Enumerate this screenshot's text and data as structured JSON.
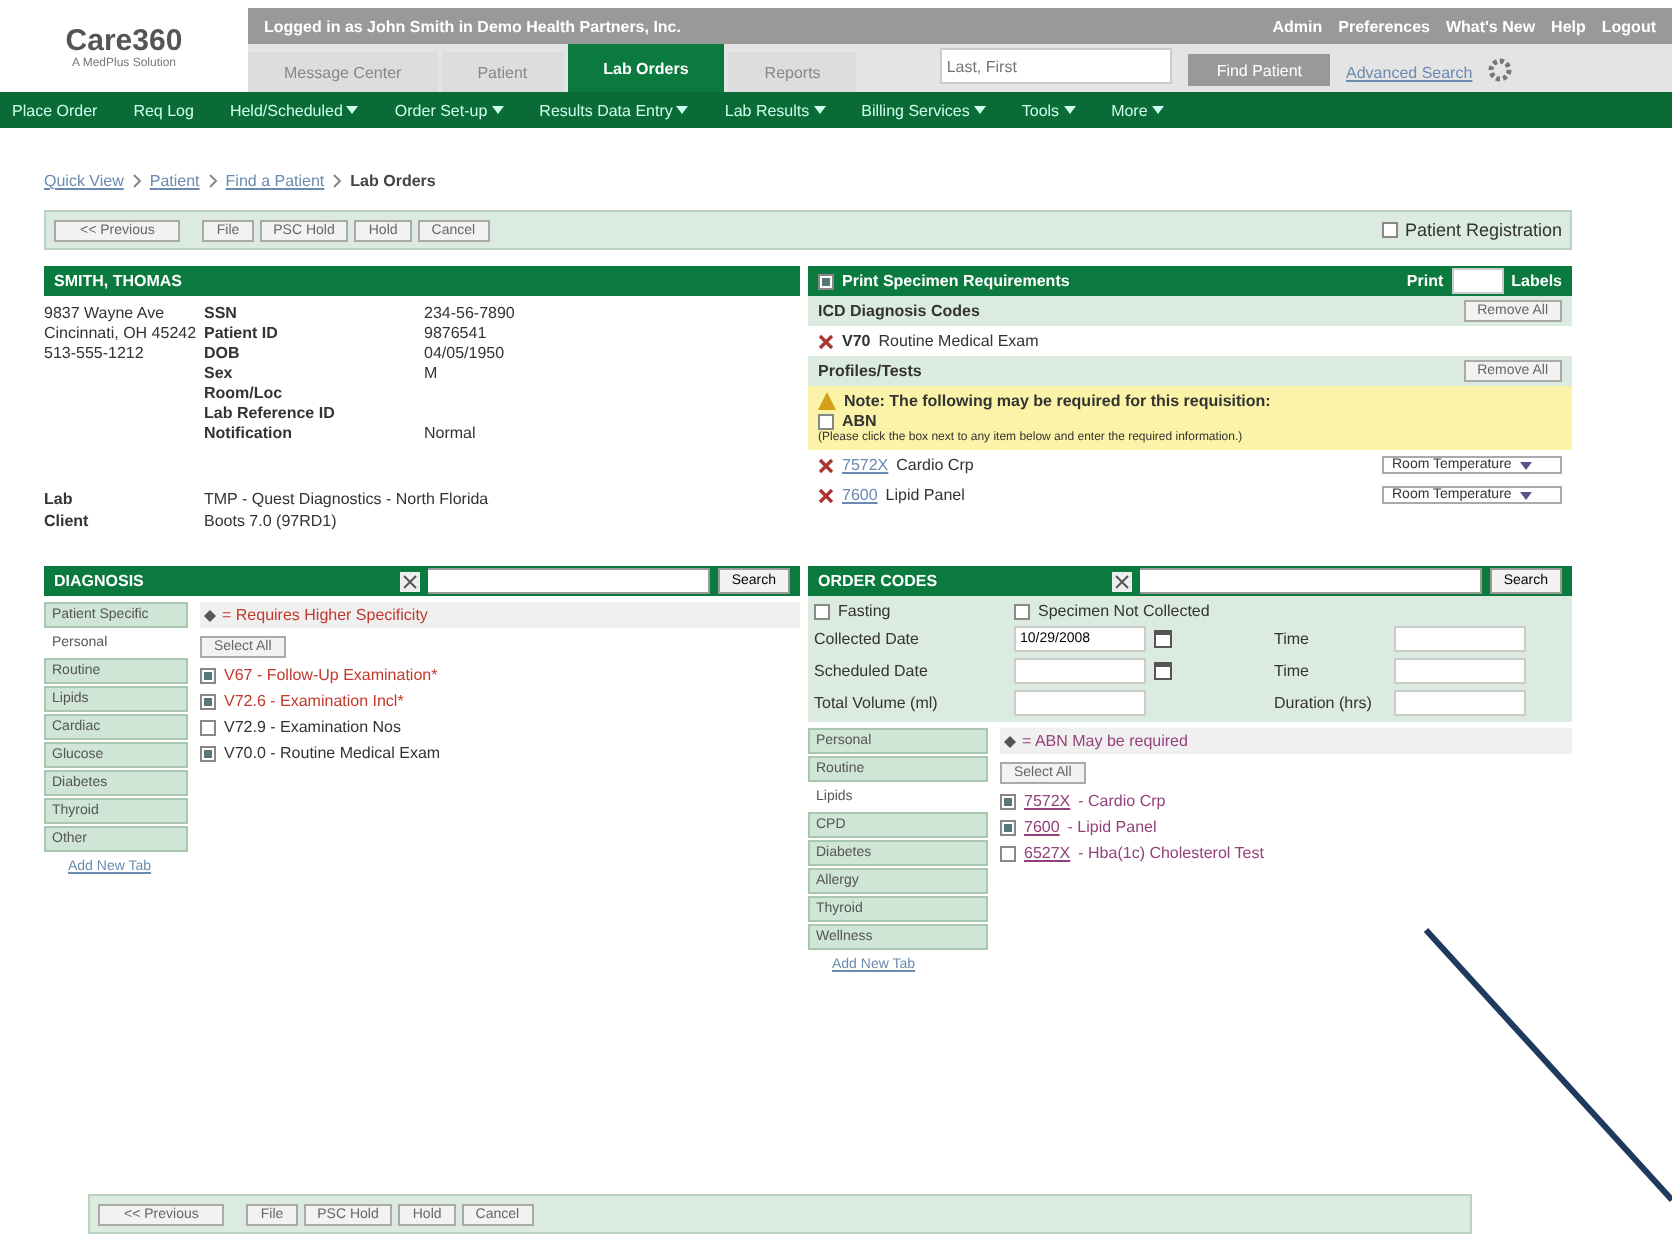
{
  "header": {
    "logo": "Care360",
    "logo_tagline": "A MedPlus Solution",
    "login_text": "Logged in as John Smith in Demo Health Partners, Inc.",
    "top_links": [
      "Admin",
      "Preferences",
      "What's New",
      "Help",
      "Logout"
    ],
    "tabs": [
      {
        "label": "Message Center",
        "selected": false
      },
      {
        "label": "Patient",
        "selected": false
      },
      {
        "label": "Lab Orders",
        "selected": true
      },
      {
        "label": "Reports",
        "selected": false
      }
    ],
    "search": {
      "placeholder": "Last, First"
    },
    "find_button": "Find Patient",
    "advanced_search": "Advanced Search"
  },
  "nav": [
    {
      "label": "Place Order",
      "dropdown": false
    },
    {
      "label": "Req Log",
      "dropdown": false
    },
    {
      "label": "Held/Scheduled",
      "dropdown": true
    },
    {
      "label": "Order Set-up",
      "dropdown": true
    },
    {
      "label": "Results Data Entry",
      "dropdown": true
    },
    {
      "label": "Lab Results",
      "dropdown": true
    },
    {
      "label": "Billing Services",
      "dropdown": true
    },
    {
      "label": "Tools",
      "dropdown": true
    },
    {
      "label": "More",
      "dropdown": true
    }
  ],
  "breadcrumb": [
    "Quick View",
    "Patient",
    "Find a Patient",
    "Lab Orders"
  ],
  "toolbar": {
    "buttons": [
      "<< Previous",
      "File",
      "PSC Hold",
      "Hold",
      "Cancel"
    ],
    "patient_registration": {
      "label": "Patient Registration",
      "checked": false
    }
  },
  "patient": {
    "name": "SMITH, THOMAS",
    "address": [
      "9837 Wayne Ave",
      "Cincinnati, OH 45242",
      "513-555-1212"
    ],
    "fields": [
      {
        "label": "SSN",
        "value": "234-56-7890"
      },
      {
        "label": "Patient ID",
        "value": "9876541"
      },
      {
        "label": "DOB",
        "value": "04/05/1950"
      },
      {
        "label": "Sex",
        "value": "M"
      },
      {
        "label": "Room/Loc"
      },
      {
        "label": "Lab Reference ID"
      },
      {
        "label": "Notification",
        "value": "Normal"
      }
    ],
    "lab": {
      "label": "Lab",
      "value": "TMP - Quest Diagnostics - North Florida"
    },
    "client": {
      "label": "Client",
      "value": "Boots 7.0 (97RD1)"
    }
  },
  "requirements": {
    "print_label": "Print Specimen Requirements",
    "print_checked": true,
    "print": "Print",
    "labels": "Labels",
    "icd_title": "ICD Diagnosis Codes",
    "remove_all": "Remove All",
    "diagnoses": [
      {
        "code": "V70",
        "name": "Routine Medical Exam"
      }
    ],
    "tests_title": "Profiles/Tests",
    "tests_remove_all": "Remove All",
    "note": {
      "text": "Note: The following may be required for this requisition:",
      "option": {
        "label": "ABN",
        "checked": false
      },
      "hint": "(Please click the box next to any item below and enter the required information.)"
    },
    "tests": [
      {
        "code": "7572X",
        "name": "Cardio Crp",
        "storage": "Room Temperature"
      },
      {
        "code": "7600",
        "name": "Lipid Panel",
        "storage": "Room Temperature"
      }
    ]
  },
  "diagnosis": {
    "title": "DIAGNOSIS",
    "search_button": "Search",
    "tabs": [
      {
        "label": "Patient Specific",
        "selected": false
      },
      {
        "label": "Personal",
        "selected": true
      },
      {
        "label": "Routine",
        "selected": false
      },
      {
        "label": "Lipids",
        "selected": false
      },
      {
        "label": "Cardiac",
        "selected": false
      },
      {
        "label": "Glucose",
        "selected": false
      },
      {
        "label": "Diabetes",
        "selected": false
      },
      {
        "label": "Thyroid",
        "selected": false
      },
      {
        "label": "Other",
        "selected": false
      }
    ],
    "add_tab": "Add New Tab",
    "legend": "= Requires Higher Specificity",
    "select_all": "Select All",
    "items": [
      {
        "label": "V67 - Follow-Up Examination*",
        "checked": true,
        "flagged": true
      },
      {
        "label": "V72.6 - Examination Incl*",
        "checked": true,
        "flagged": true
      },
      {
        "label": "V72.9 - Examination Nos",
        "checked": false,
        "flagged": false
      },
      {
        "label": "V70.0 - Routine Medical Exam",
        "checked": true,
        "flagged": false
      }
    ]
  },
  "order_codes": {
    "title": "ORDER CODES",
    "search_button": "Search",
    "fasting": {
      "label": "Fasting",
      "checked": false
    },
    "not_collected": {
      "label": "Specimen Not Collected",
      "checked": false
    },
    "collected_date": {
      "label": "Collected Date",
      "value": "10/29/2008"
    },
    "collected_time": "Time",
    "scheduled_date": "Scheduled Date",
    "scheduled_time": "Time",
    "total_volume": "Total Volume (ml)",
    "duration": "Duration (hrs)",
    "tabs": [
      {
        "label": "Personal",
        "selected": false
      },
      {
        "label": "Routine",
        "selected": false
      },
      {
        "label": "Lipids",
        "selected": true
      },
      {
        "label": "CPD",
        "selected": false
      },
      {
        "label": "Diabetes",
        "selected": false
      },
      {
        "label": "Allergy",
        "selected": false
      },
      {
        "label": "Thyroid",
        "selected": false
      },
      {
        "label": "Wellness",
        "selected": false
      }
    ],
    "add_tab": "Add New Tab",
    "legend": "= ABN May be required",
    "select_all": "Select All",
    "items": [
      {
        "code": "7572X",
        "name": "- Cardio Crp",
        "checked": true
      },
      {
        "code": "7600",
        "name": "- Lipid Panel",
        "checked": true
      },
      {
        "code": "6527X",
        "name": "- Hba(1c) Cholesterol Test",
        "checked": false
      }
    ]
  },
  "bottom_toolbar": {
    "buttons": [
      "<< Previous",
      "File",
      "PSC Hold",
      "Hold",
      "Cancel"
    ]
  }
}
